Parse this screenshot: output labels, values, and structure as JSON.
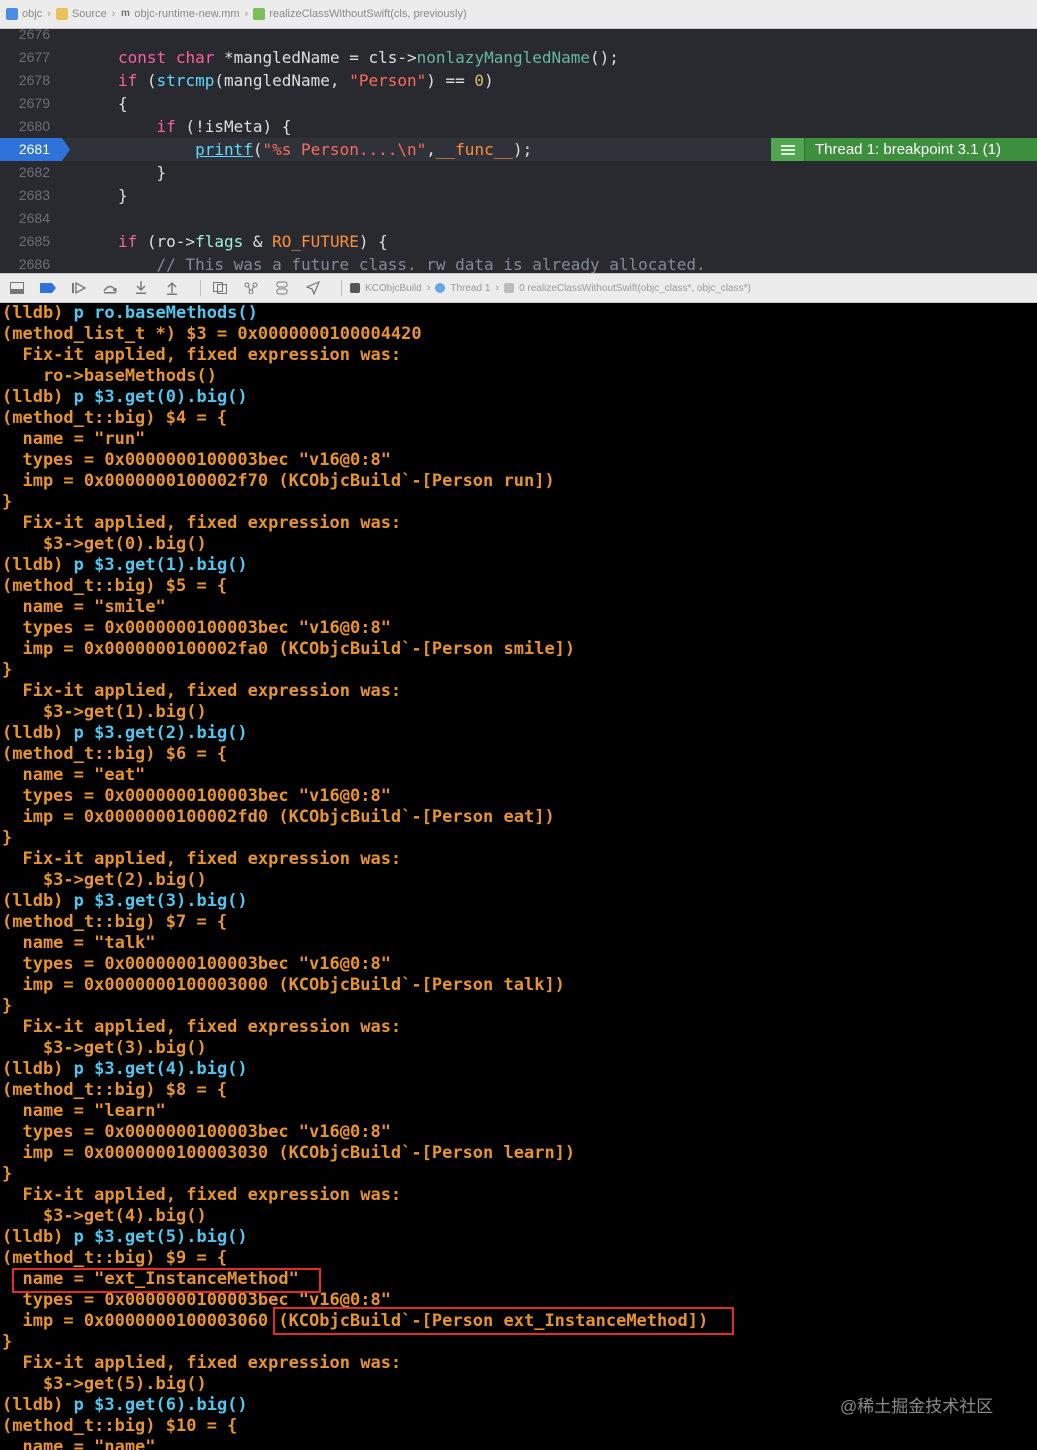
{
  "jumpbar": {
    "crumbs": [
      "objc",
      "Source",
      "objc-runtime-new.mm",
      "realizeClassWithoutSwift(cls, previously)"
    ]
  },
  "editor": {
    "lines": [
      {
        "num": "2676",
        "code": ""
      },
      {
        "num": "2677",
        "code": "const char *mangledName = cls->nonlazyMangledName();"
      },
      {
        "num": "2678",
        "code": "if (strcmp(mangledName, \"Person\") == 0)"
      },
      {
        "num": "2679",
        "code": "{"
      },
      {
        "num": "2680",
        "code": "    if (!isMeta) {"
      },
      {
        "num": "2681",
        "code": "        printf(\"%s Person....\\n\",__func__);"
      },
      {
        "num": "2682",
        "code": "    }"
      },
      {
        "num": "2683",
        "code": "}"
      },
      {
        "num": "2684",
        "code": ""
      },
      {
        "num": "2685",
        "code": "if (ro->flags & RO_FUTURE) {"
      },
      {
        "num": "2686",
        "code": "    // This was a future class. rw data is already allocated."
      }
    ],
    "current_line": "2681",
    "thread_badge": "Thread 1: breakpoint 3.1 (1)"
  },
  "debugbar": {
    "crumbs": [
      "KCObjcBuild",
      "Thread 1",
      "0 realizeClassWithoutSwift(objc_class*, objc_class*)"
    ]
  },
  "console": {
    "lines": [
      {
        "t": "cmd",
        "prompt": "(lldb) ",
        "text": "p ro.baseMethods()"
      },
      {
        "t": "out",
        "text": "(method_list_t *) $3 = 0x0000000100004420"
      },
      {
        "t": "out",
        "text": "  Fix-it applied, fixed expression was: "
      },
      {
        "t": "out",
        "text": "    ro->baseMethods()"
      },
      {
        "t": "cmd",
        "prompt": "(lldb) ",
        "text": "p $3.get(0).big()"
      },
      {
        "t": "out",
        "text": "(method_t::big) $4 = {"
      },
      {
        "t": "out",
        "text": "  name = \"run\""
      },
      {
        "t": "out",
        "text": "  types = 0x0000000100003bec \"v16@0:8\""
      },
      {
        "t": "out",
        "text": "  imp = 0x0000000100002f70 (KCObjcBuild`-[Person run])"
      },
      {
        "t": "out",
        "text": "}"
      },
      {
        "t": "out",
        "text": "  Fix-it applied, fixed expression was: "
      },
      {
        "t": "out",
        "text": "    $3->get(0).big()"
      },
      {
        "t": "cmd",
        "prompt": "(lldb) ",
        "text": "p $3.get(1).big()"
      },
      {
        "t": "out",
        "text": "(method_t::big) $5 = {"
      },
      {
        "t": "out",
        "text": "  name = \"smile\""
      },
      {
        "t": "out",
        "text": "  types = 0x0000000100003bec \"v16@0:8\""
      },
      {
        "t": "out",
        "text": "  imp = 0x0000000100002fa0 (KCObjcBuild`-[Person smile])"
      },
      {
        "t": "out",
        "text": "}"
      },
      {
        "t": "out",
        "text": "  Fix-it applied, fixed expression was: "
      },
      {
        "t": "out",
        "text": "    $3->get(1).big()"
      },
      {
        "t": "cmd",
        "prompt": "(lldb) ",
        "text": "p $3.get(2).big()"
      },
      {
        "t": "out",
        "text": "(method_t::big) $6 = {"
      },
      {
        "t": "out",
        "text": "  name = \"eat\""
      },
      {
        "t": "out",
        "text": "  types = 0x0000000100003bec \"v16@0:8\""
      },
      {
        "t": "out",
        "text": "  imp = 0x0000000100002fd0 (KCObjcBuild`-[Person eat])"
      },
      {
        "t": "out",
        "text": "}"
      },
      {
        "t": "out",
        "text": "  Fix-it applied, fixed expression was: "
      },
      {
        "t": "out",
        "text": "    $3->get(2).big()"
      },
      {
        "t": "cmd",
        "prompt": "(lldb) ",
        "text": "p $3.get(3).big()"
      },
      {
        "t": "out",
        "text": "(method_t::big) $7 = {"
      },
      {
        "t": "out",
        "text": "  name = \"talk\""
      },
      {
        "t": "out",
        "text": "  types = 0x0000000100003bec \"v16@0:8\""
      },
      {
        "t": "out",
        "text": "  imp = 0x0000000100003000 (KCObjcBuild`-[Person talk])"
      },
      {
        "t": "out",
        "text": "}"
      },
      {
        "t": "out",
        "text": "  Fix-it applied, fixed expression was: "
      },
      {
        "t": "out",
        "text": "    $3->get(3).big()"
      },
      {
        "t": "cmd",
        "prompt": "(lldb) ",
        "text": "p $3.get(4).big()"
      },
      {
        "t": "out",
        "text": "(method_t::big) $8 = {"
      },
      {
        "t": "out",
        "text": "  name = \"learn\""
      },
      {
        "t": "out",
        "text": "  types = 0x0000000100003bec \"v16@0:8\""
      },
      {
        "t": "out",
        "text": "  imp = 0x0000000100003030 (KCObjcBuild`-[Person learn])"
      },
      {
        "t": "out",
        "text": "}"
      },
      {
        "t": "out",
        "text": "  Fix-it applied, fixed expression was: "
      },
      {
        "t": "out",
        "text": "    $3->get(4).big()"
      },
      {
        "t": "cmd",
        "prompt": "(lldb) ",
        "text": "p $3.get(5).big()"
      },
      {
        "t": "out",
        "text": "(method_t::big) $9 = {"
      },
      {
        "t": "out",
        "text": "  name = \"ext_InstanceMethod\""
      },
      {
        "t": "out",
        "text": "  types = 0x0000000100003bec \"v16@0:8\""
      },
      {
        "t": "out",
        "text": "  imp = 0x0000000100003060 (KCObjcBuild`-[Person ext_InstanceMethod])"
      },
      {
        "t": "out",
        "text": "}"
      },
      {
        "t": "out",
        "text": "  Fix-it applied, fixed expression was: "
      },
      {
        "t": "out",
        "text": "    $3->get(5).big()"
      },
      {
        "t": "cmd",
        "prompt": "(lldb) ",
        "text": "p $3.get(6).big()"
      },
      {
        "t": "out",
        "text": "(method_t::big) $10 = {"
      },
      {
        "t": "out",
        "text": "  name = \"name\""
      }
    ]
  },
  "watermark": "@稀土掘金技术社区",
  "colors": {
    "console_output": "#e8942b",
    "console_command": "#4ec8f0",
    "highlight_box": "#e32b2b",
    "thread_badge": "#3d8f3d",
    "editor_bg": "#292a30"
  }
}
